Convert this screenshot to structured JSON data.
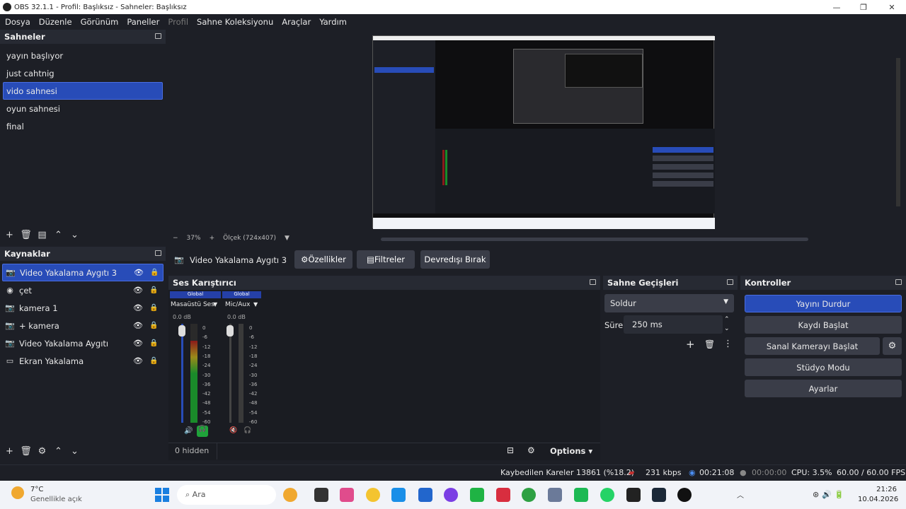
{
  "window": {
    "title": "OBS 32.1.1 - Profil: Başlıksız - Sahneler: Başlıksız",
    "minimize": "—",
    "maximize": "❐",
    "close": "✕"
  },
  "menu": [
    "Dosya",
    "Düzenle",
    "Görünüm",
    "Paneller",
    "Profil",
    "Sahne Koleksiyonu",
    "Araçlar",
    "Yardım"
  ],
  "scenes": {
    "title": "Sahneler",
    "items": [
      "yayın başlıyor",
      "just cahtnig",
      "vido sahnesi",
      "oyun sahnesi",
      "final"
    ],
    "selected": "vido sahnesi"
  },
  "preview": {
    "zoom": "37%",
    "size_label": "Ölçek (724x407)"
  },
  "sources": {
    "title": "Kaynaklar",
    "items": [
      {
        "icon": "camera-icon",
        "label": "Video Yakalama Aygıtı 3",
        "selected": true
      },
      {
        "icon": "browser-icon",
        "label": "çet",
        "selected": false
      },
      {
        "icon": "camera-icon",
        "label": "kamera 1",
        "selected": false
      },
      {
        "icon": "camera-icon",
        "label": "+ kamera",
        "selected": false
      },
      {
        "icon": "camera-icon",
        "label": "Video Yakalama Aygıtı",
        "selected": false
      },
      {
        "icon": "monitor-icon",
        "label": "Ekran Yakalama",
        "selected": false
      }
    ]
  },
  "source_toolbar": {
    "source_name": "Video Yakalama Aygıtı 3",
    "properties": "Özellikler",
    "filters": "Filtreler",
    "deactivate": "Devredışı Bırak"
  },
  "mixer": {
    "title": "Ses Karıştırıcı",
    "channels": [
      {
        "badge": "Global",
        "name": "Masaüstü Ses",
        "db": "0.0 dB",
        "level": 0.83
      },
      {
        "badge": "Global",
        "name": "Mic/Aux",
        "db": "0.0 dB",
        "level": 0.0
      }
    ],
    "ticks": [
      "0",
      "-6",
      "-12",
      "-18",
      "-24",
      "-30",
      "-36",
      "-42",
      "-48",
      "-54",
      "-60"
    ],
    "hidden": "0 hidden",
    "options": "Options"
  },
  "transitions": {
    "title": "Sahne Geçişleri",
    "selected": "Soldur",
    "duration_label": "Süre",
    "duration_value": "250 ms"
  },
  "controls": {
    "title": "Kontroller",
    "buttons": [
      "Yayını Durdur",
      "Kaydı Başlat",
      "Sanal Kamerayı Başlat",
      "Stüdyo Modu",
      "Ayarlar"
    ]
  },
  "status": {
    "dropped": "Kaybedilen Kareler 13861 (%18.2)",
    "bitrate": "231 kbps",
    "stream_time": "00:21:08",
    "record_time": "00:00:00",
    "cpu": "CPU: 3.5%",
    "fps": "60.00 / 60.00 FPS"
  },
  "taskbar": {
    "weather_temp": "7°C",
    "weather_desc": "Genellikle açık",
    "search": "Ara",
    "time": "21:26",
    "date": "10.04.2026",
    "colors": [
      "#f0a830",
      "#333",
      "#e04c8c",
      "#f4c430",
      "#1a8fe8",
      "#2266cc",
      "#7b3fe4",
      "#1fb344",
      "#d82e3f",
      "#2ea043",
      "#6b7a99",
      "#1db954",
      "#25d366",
      "#222",
      "#1b2838",
      "#111"
    ]
  }
}
